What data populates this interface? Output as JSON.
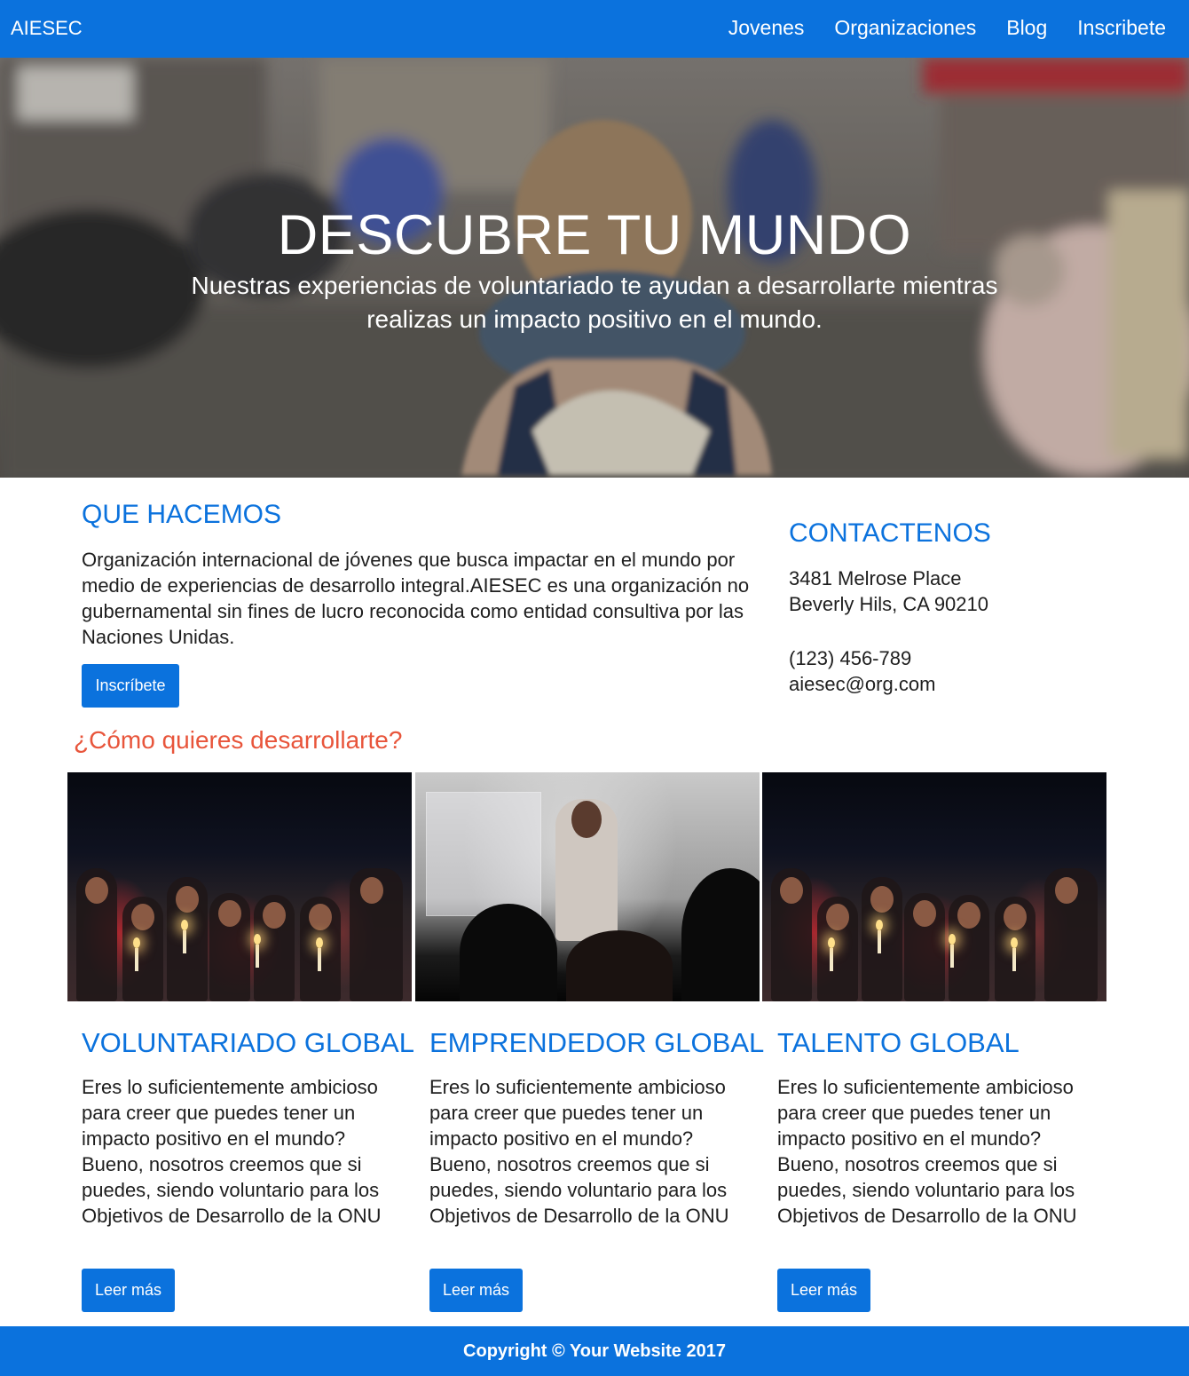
{
  "nav": {
    "brand": "AIESEC",
    "links": [
      "Jovenes",
      "Organizaciones",
      "Blog",
      "Inscribete"
    ]
  },
  "hero": {
    "title": "DESCUBRE TU MUNDO",
    "subtitle": "Nuestras experiencias de voluntariado te ayudan a desarrollarte mientras realizas un impacto positivo en el mundo."
  },
  "about": {
    "title": "QUE HACEMOS",
    "text": "Organización internacional de jóvenes que busca impactar en el mundo por medio de experiencias de desarrollo integral.AIESEC es una organización no gubernamental sin fines de lucro reconocida como entidad consultiva por las Naciones Unidas.",
    "button": "Inscríbete"
  },
  "contact": {
    "title": "CONTACTENOS",
    "address_line1": "3481 Melrose Place",
    "address_line2": "Beverly Hils, CA 90210",
    "phone": "(123) 456-789",
    "email": "aiesec@org.com"
  },
  "develop": {
    "title": "¿Cómo quieres desarrollarte?",
    "cards": [
      {
        "title": "VOLUNTARIADO GLOBAL",
        "text": "Eres lo suficientemente ambicioso para creer que puedes tener un impacto positivo en el mundo? Bueno, nosotros creemos que si puedes, siendo voluntario para los Objetivos de Desarrollo de la ONU",
        "button": "Leer más"
      },
      {
        "title": "EMPRENDEDOR GLOBAL",
        "text": "Eres lo suficientemente ambicioso para creer que puedes tener un impacto positivo en el mundo? Bueno, nosotros creemos que si puedes, siendo voluntario para los Objetivos de Desarrollo de la ONU",
        "button": "Leer más"
      },
      {
        "title": "TALENTO GLOBAL",
        "text": "Eres lo suficientemente ambicioso para creer que puedes tener un impacto positivo en el mundo? Bueno, nosotros creemos que si puedes, siendo voluntario para los Objetivos de Desarrollo de la ONU",
        "button": "Leer más"
      }
    ]
  },
  "footer": {
    "text": "Copyright © Your Website 2017"
  },
  "colors": {
    "primary": "#0b72dd",
    "accent": "#e8553b"
  }
}
